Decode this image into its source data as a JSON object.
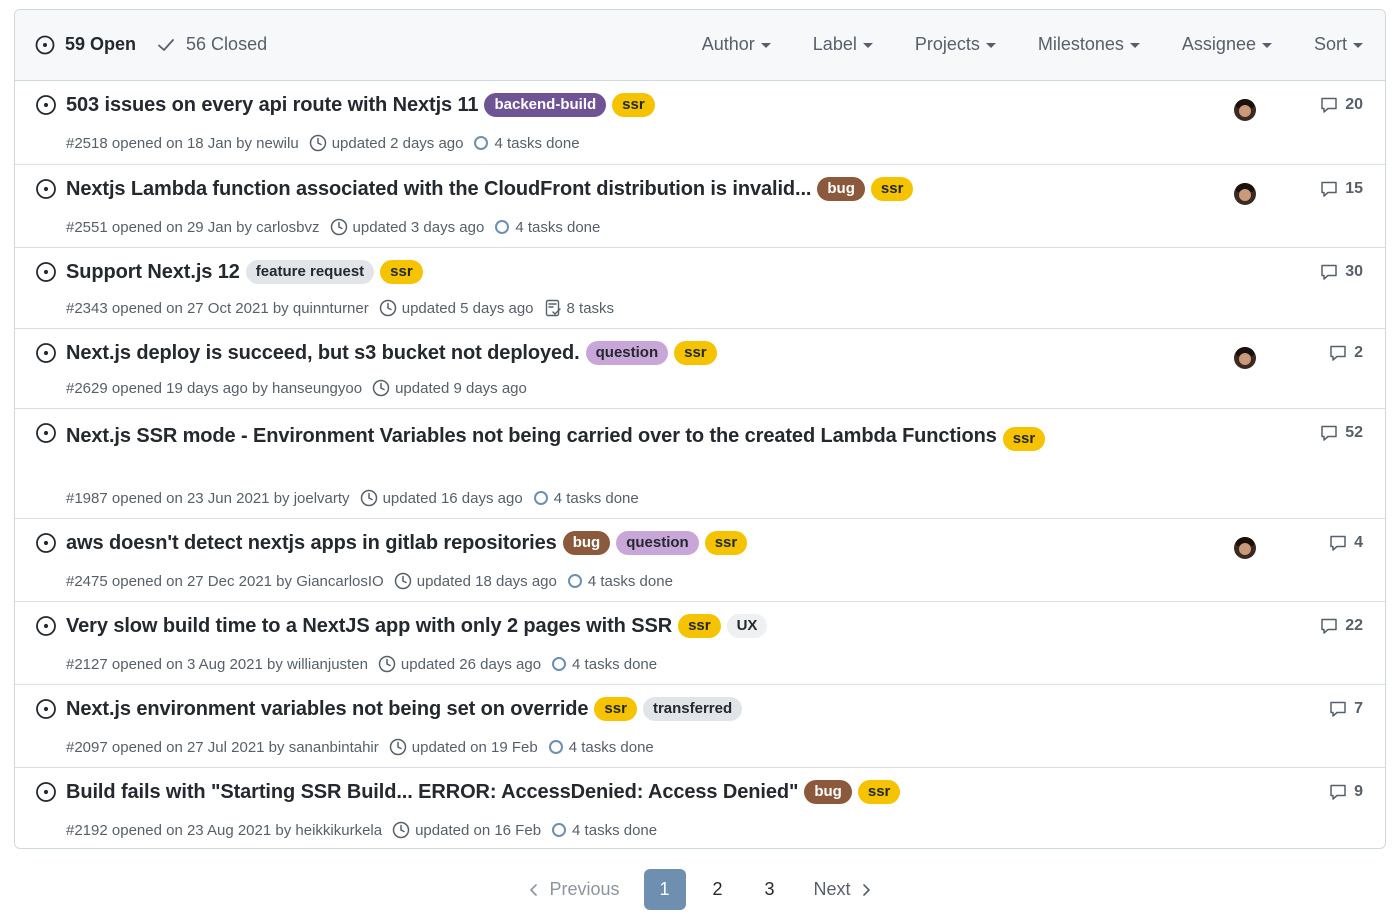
{
  "header": {
    "open_label": "59 Open",
    "closed_label": "56 Closed",
    "filters": [
      "Author",
      "Label",
      "Projects",
      "Milestones",
      "Assignee",
      "Sort"
    ]
  },
  "issues": [
    {
      "title": "503 issues on every api route with Nextjs 11",
      "labels": [
        {
          "text": "backend-build",
          "bg": "#6e5494",
          "fg": "#ffffff"
        },
        {
          "text": "ssr",
          "bg": "#f6c300",
          "fg": "#24292f"
        }
      ],
      "meta": "#2518 opened on 18 Jan by newilu",
      "updated": "updated 2 days ago",
      "tasks": "4 tasks done",
      "tasks_icon": "task-progress",
      "assignee": true,
      "comments": "20"
    },
    {
      "title": "Nextjs Lambda function associated with the CloudFront distribution is invalid...",
      "labels": [
        {
          "text": "bug",
          "bg": "#8b5a3c",
          "fg": "#ffffff"
        },
        {
          "text": "ssr",
          "bg": "#f6c300",
          "fg": "#24292f"
        }
      ],
      "meta": "#2551 opened on 29 Jan by carlosbvz",
      "updated": "updated 3 days ago",
      "tasks": "4 tasks done",
      "tasks_icon": "task-progress",
      "assignee": true,
      "comments": "15"
    },
    {
      "title": "Support Next.js 12",
      "labels": [
        {
          "text": "feature request",
          "bg": "#e1e4e8",
          "fg": "#24292f"
        },
        {
          "text": "ssr",
          "bg": "#f6c300",
          "fg": "#24292f"
        }
      ],
      "meta": "#2343 opened on 27 Oct 2021 by quinnturner",
      "updated": "updated 5 days ago",
      "tasks": "8 tasks",
      "tasks_icon": "checklist",
      "assignee": false,
      "comments": "30"
    },
    {
      "title": "Next.js deploy is succeed, but s3 bucket not deployed.",
      "labels": [
        {
          "text": "question",
          "bg": "#c9a6d8",
          "fg": "#24292f"
        },
        {
          "text": "ssr",
          "bg": "#f6c300",
          "fg": "#24292f"
        }
      ],
      "meta": "#2629 opened 19 days ago by hanseungyoo",
      "updated": "updated 9 days ago",
      "tasks": "",
      "tasks_icon": "",
      "assignee": true,
      "comments": "2"
    },
    {
      "title": "Next.js SSR mode - Environment Variables not being carried over to the created Lambda Functions",
      "labels": [
        {
          "text": "ssr",
          "bg": "#f6c300",
          "fg": "#24292f"
        }
      ],
      "meta": "#1987 opened on 23 Jun 2021 by joelvarty",
      "updated": "updated 16 days ago",
      "tasks": "4 tasks done",
      "tasks_icon": "task-progress",
      "assignee": false,
      "comments": "52"
    },
    {
      "title": "aws doesn't detect nextjs apps in gitlab repositories",
      "labels": [
        {
          "text": "bug",
          "bg": "#8b5a3c",
          "fg": "#ffffff"
        },
        {
          "text": "question",
          "bg": "#c9a6d8",
          "fg": "#24292f"
        },
        {
          "text": "ssr",
          "bg": "#f6c300",
          "fg": "#24292f"
        }
      ],
      "meta": "#2475 opened on 27 Dec 2021 by GiancarlosIO",
      "updated": "updated 18 days ago",
      "tasks": "4 tasks done",
      "tasks_icon": "task-progress",
      "assignee": true,
      "comments": "4"
    },
    {
      "title": "Very slow build time to a NextJS app with only 2 pages with SSR",
      "labels": [
        {
          "text": "ssr",
          "bg": "#f6c300",
          "fg": "#24292f"
        },
        {
          "text": "UX",
          "bg": "#eef0f2",
          "fg": "#24292f"
        }
      ],
      "meta": "#2127 opened on 3 Aug 2021 by willianjusten",
      "updated": "updated 26 days ago",
      "tasks": "4 tasks done",
      "tasks_icon": "task-progress",
      "assignee": false,
      "comments": "22"
    },
    {
      "title": "Next.js environment variables not being set on override",
      "labels": [
        {
          "text": "ssr",
          "bg": "#f6c300",
          "fg": "#24292f"
        },
        {
          "text": "transferred",
          "bg": "#e1e4e8",
          "fg": "#24292f"
        }
      ],
      "meta": "#2097 opened on 27 Jul 2021 by sananbintahir",
      "updated": "updated on 19 Feb",
      "tasks": "4 tasks done",
      "tasks_icon": "task-progress",
      "assignee": false,
      "comments": "7"
    },
    {
      "title": "Build fails with \"Starting SSR Build... ERROR: AccessDenied: Access Denied\"",
      "labels": [
        {
          "text": "bug",
          "bg": "#8b5a3c",
          "fg": "#ffffff"
        },
        {
          "text": "ssr",
          "bg": "#f6c300",
          "fg": "#24292f"
        }
      ],
      "meta": "#2192 opened on 23 Aug 2021 by heikkikurkela",
      "updated": "updated on 16 Feb",
      "tasks": "4 tasks done",
      "tasks_icon": "task-progress",
      "assignee": false,
      "comments": "9"
    }
  ],
  "pagination": {
    "previous": "Previous",
    "pages": [
      "1",
      "2",
      "3"
    ],
    "current": "1",
    "next": "Next"
  }
}
